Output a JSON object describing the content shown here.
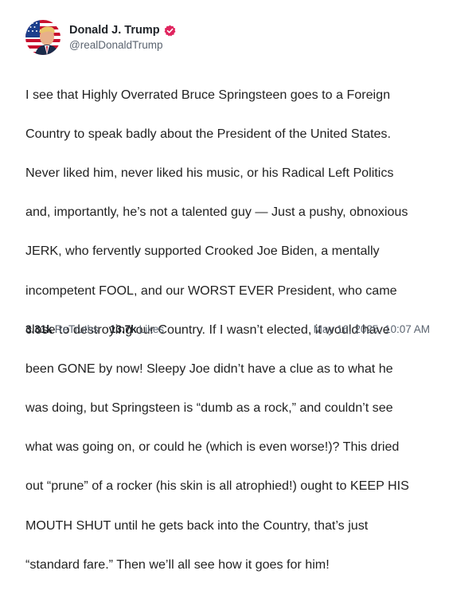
{
  "author": {
    "display_name": "Donald J. Trump",
    "handle": "@realDonaldTrump",
    "avatar_icon": "flag-portrait-avatar",
    "verified_icon": "verified-badge-icon",
    "verified_color": "#e0245e"
  },
  "post": {
    "lines": [
      "I see that Highly Overrated Bruce Springsteen goes to a Foreign",
      "Country to speak badly about the President of the United States.",
      "Never liked him, never liked his music, or his Radical Left Politics",
      "and, importantly, he’s not a talented guy — Just a pushy, obnoxious",
      "JERK, who fervently supported Crooked Joe Biden, a mentally",
      "incompetent FOOL, and our WORST EVER President, who came",
      "close to destroying our Country. If I wasn’t elected, it would have",
      "been GONE by now! Sleepy Joe didn’t have a clue as to what he",
      "was doing, but Springsteen is “dumb as a rock,” and couldn’t see",
      "what was going on, or could he (which is even worse!)? This dried",
      "out “prune” of a rocker (his skin is all atrophied!) ought to KEEP HIS",
      "MOUTH SHUT until he gets back into the Country, that’s just",
      "“standard fare.” Then we’ll all see how it goes for him!"
    ]
  },
  "stats": {
    "retruths_count": "3.31k",
    "retruths_label": "ReTruths",
    "likes_count": "13.7k",
    "likes_label": "Likes"
  },
  "timestamp": "May 16, 2025, 10:07 AM"
}
